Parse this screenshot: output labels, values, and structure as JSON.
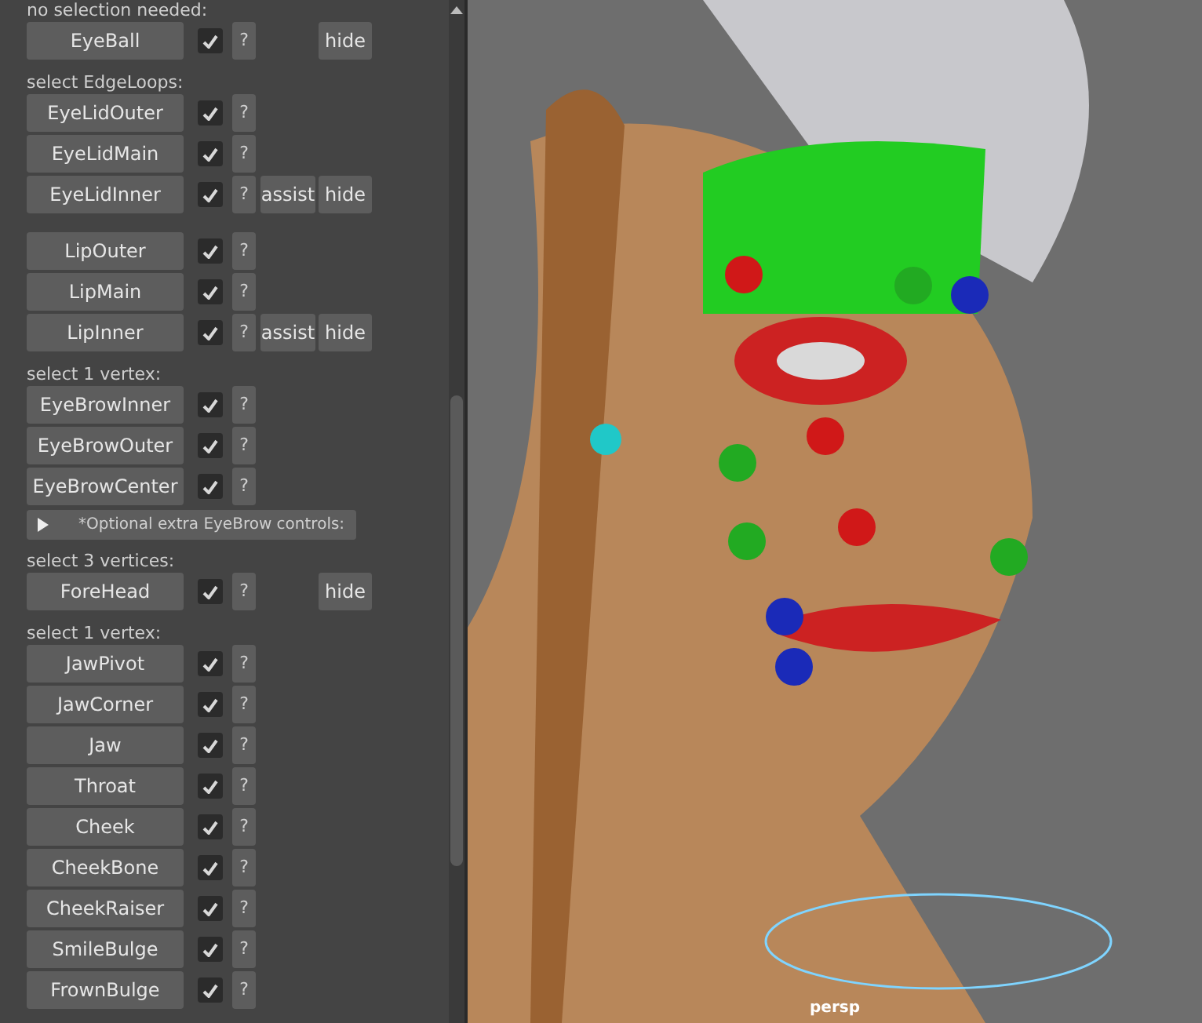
{
  "sections": [
    {
      "kind": "group",
      "label": "no selection needed:",
      "items": [
        {
          "name": "EyeBall",
          "checked": true,
          "help": "?",
          "hide": "hide"
        }
      ]
    },
    {
      "kind": "group",
      "label": "select EdgeLoops:",
      "items": [
        {
          "name": "EyeLidOuter",
          "checked": true,
          "help": "?"
        },
        {
          "name": "EyeLidMain",
          "checked": true,
          "help": "?"
        },
        {
          "name": "EyeLidInner",
          "checked": true,
          "help": "?",
          "assist": "assist",
          "hide": "hide"
        }
      ]
    },
    {
      "kind": "group",
      "items": [
        {
          "name": "LipOuter",
          "checked": true,
          "help": "?"
        },
        {
          "name": "LipMain",
          "checked": true,
          "help": "?"
        },
        {
          "name": "LipInner",
          "checked": true,
          "help": "?",
          "assist": "assist",
          "hide": "hide"
        }
      ]
    },
    {
      "kind": "group",
      "label": "select 1 vertex:",
      "items": [
        {
          "name": "EyeBrowInner",
          "checked": true,
          "help": "?"
        },
        {
          "name": "EyeBrowOuter",
          "checked": true,
          "help": "?"
        },
        {
          "name": "EyeBrowCenter",
          "checked": true,
          "help": "?"
        }
      ]
    },
    {
      "kind": "frame",
      "label": "*Optional extra EyeBrow controls:",
      "expanded": false
    },
    {
      "kind": "group",
      "label": "select 3 vertices:",
      "items": [
        {
          "name": "ForeHead",
          "checked": true,
          "help": "?",
          "hide": "hide"
        }
      ]
    },
    {
      "kind": "group",
      "label": "select 1 vertex:",
      "items": [
        {
          "name": "JawPivot",
          "checked": true,
          "help": "?"
        },
        {
          "name": "JawCorner",
          "checked": true,
          "help": "?"
        },
        {
          "name": "Jaw",
          "checked": true,
          "help": "?"
        },
        {
          "name": "Throat",
          "checked": true,
          "help": "?"
        },
        {
          "name": "Cheek",
          "checked": true,
          "help": "?"
        },
        {
          "name": "CheekBone",
          "checked": true,
          "help": "?"
        },
        {
          "name": "CheekRaiser",
          "checked": true,
          "help": "?"
        },
        {
          "name": "SmileBulge",
          "checked": true,
          "help": "?"
        },
        {
          "name": "FrownBulge",
          "checked": true,
          "help": "?"
        }
      ]
    }
  ],
  "viewport": {
    "camera": "persp"
  }
}
